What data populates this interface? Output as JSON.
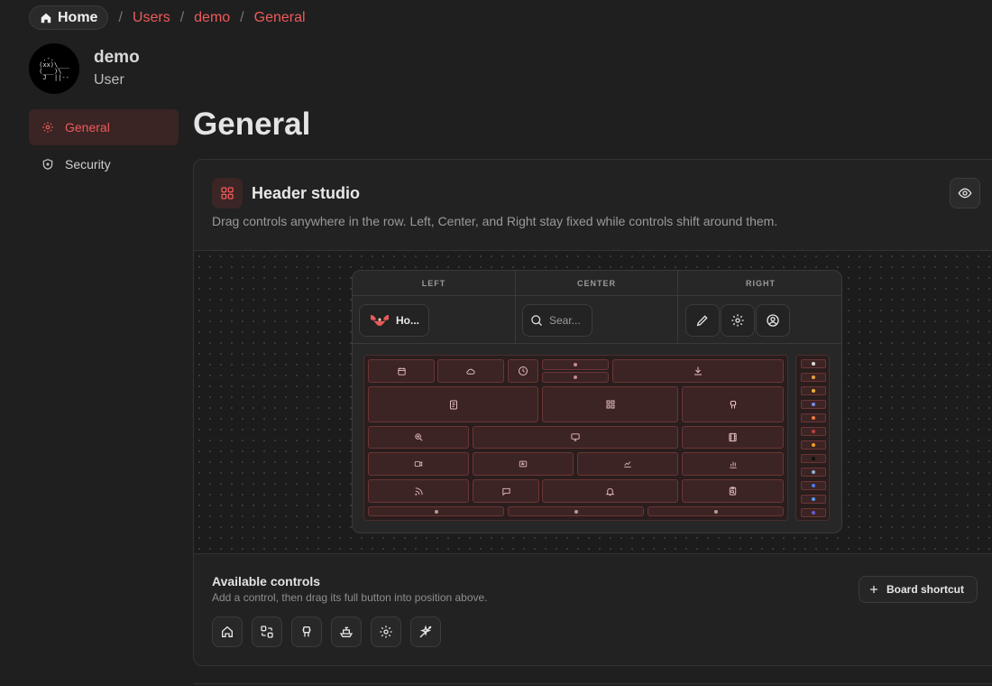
{
  "breadcrumb": {
    "home_label": "Home",
    "items": [
      "Users",
      "demo",
      "General"
    ],
    "separator": "/"
  },
  "user": {
    "name": "demo",
    "role": "User",
    "avatar_art": " .-.   \n(xx)\\___\n(___)\\  \n J  ||--"
  },
  "sidebar": {
    "items": [
      {
        "label": "General",
        "icon": "gear-icon",
        "active": true
      },
      {
        "label": "Security",
        "icon": "shield-icon",
        "active": false
      }
    ]
  },
  "page": {
    "title": "General"
  },
  "card": {
    "title": "Header studio",
    "description": "Drag controls anywhere in the row. Left, Center, and Right stay fixed while controls shift around them.",
    "icon": "layout-grid-icon",
    "preview_toggle_icon": "eye-icon"
  },
  "preview": {
    "zones": [
      {
        "label": "LEFT"
      },
      {
        "label": "CENTER"
      },
      {
        "label": "RIGHT"
      }
    ],
    "left_control": {
      "label": "Ho...",
      "icon": "logo-icon"
    },
    "center_control": {
      "placeholder": "Sear...",
      "icon": "search-icon"
    },
    "right_controls": [
      "pencil-icon",
      "gear-icon",
      "user-circle-icon"
    ]
  },
  "available": {
    "title": "Available controls",
    "description": "Add a control, then drag its full button into position above.",
    "shortcut_label": "Board shortcut",
    "tools": [
      "home-icon",
      "swap-icon",
      "robot-icon",
      "ship-icon",
      "gear-icon",
      "sparkle-off-icon"
    ]
  },
  "colors": {
    "accent": "#ef5a5a",
    "background": "#1f1f1f",
    "card": "#222222"
  }
}
